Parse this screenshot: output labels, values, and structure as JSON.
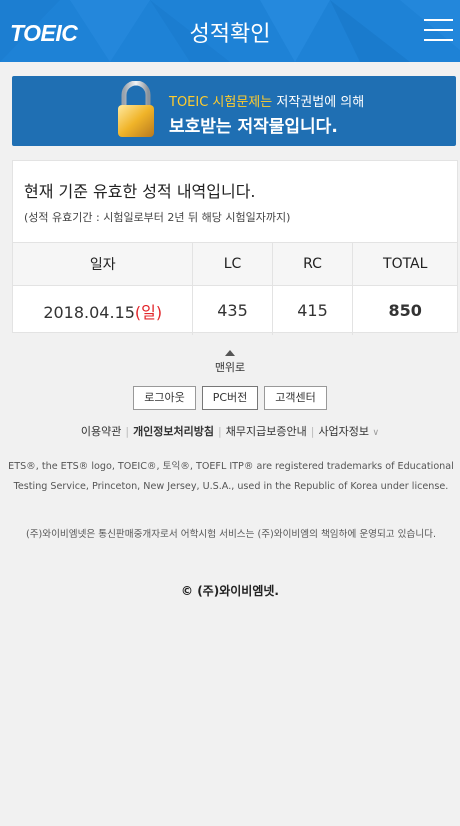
{
  "header": {
    "logo": "TOEIC",
    "title": "성적확인",
    "menu_icon": "hamburger-menu-icon"
  },
  "banner": {
    "icon": "padlock-icon",
    "line1_highlight": "TOEIC 시험문제는",
    "line1_rest": " 저작권법에 의해",
    "line2": "보호받는 저작물입니다."
  },
  "score_card": {
    "title": "현재 기준 유효한 성적 내역입니다.",
    "subtitle": "(성적 유효기간 : 시험일로부터 2년 뒤 해당 시험일자까지)",
    "columns": [
      "일자",
      "LC",
      "RC",
      "TOTAL"
    ],
    "rows": [
      {
        "date": "2018.04.15",
        "day": "(일)",
        "lc": "435",
        "rc": "415",
        "total": "850"
      }
    ]
  },
  "footer": {
    "to_top": "맨위로",
    "buttons": [
      "로그아웃",
      "PC버전",
      "고객센터"
    ],
    "links": [
      "이용약관",
      "개인정보처리방침",
      "채무지급보증안내",
      "사업자정보"
    ],
    "legal": "ETS®, the ETS® logo, TOEIC®, 토익®, TOEFL ITP® are registered trademarks of Educational Testing Service, Princeton, New Jersey, U.S.A., used in the Republic of Korea under license.",
    "legal2": "(주)와이비엠넷은 통신판매중개자로서 어학시험 서비스는 (주)와이비엠의 책임하에 운영되고 있습니다.",
    "copyright": "© (주)와이비엠넷."
  },
  "colors": {
    "header_bg": "#1e82d6",
    "banner_bg": "#1f6fb3",
    "banner_highlight": "#ffcc2e",
    "total_value": "#1f6fd0",
    "day_red": "#e2262b"
  }
}
